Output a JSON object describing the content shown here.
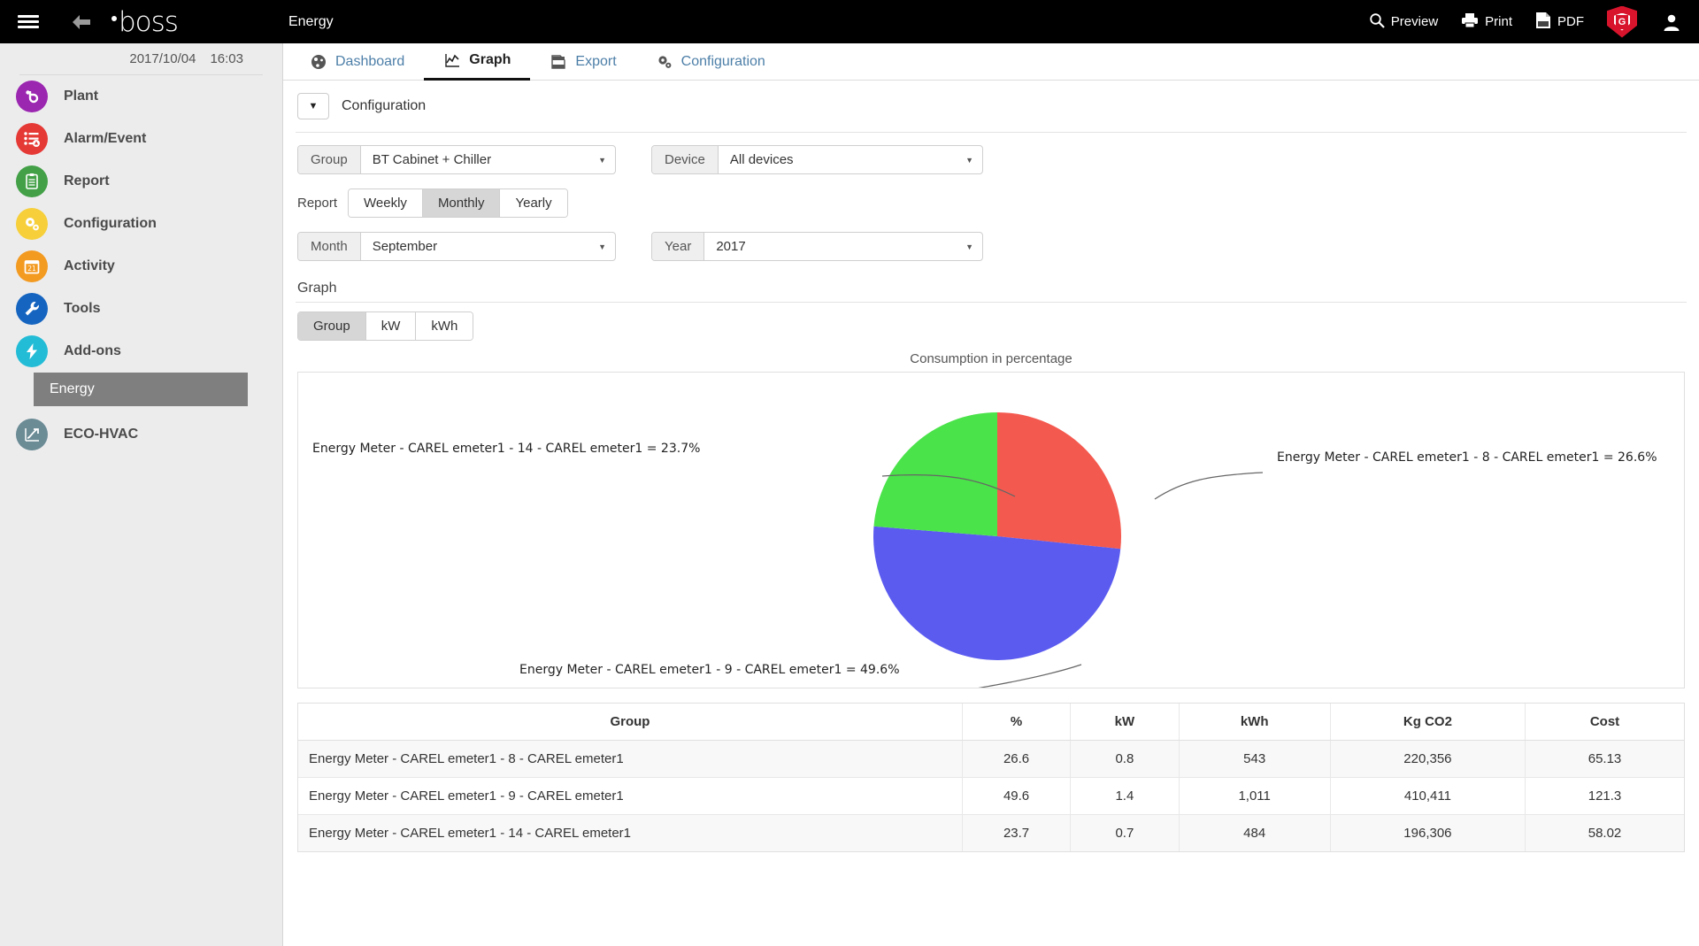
{
  "topbar": {
    "menu_icon": "hamburger-icon",
    "back_icon": "back-arrow-icon",
    "brand": "boss",
    "page_title": "Energy",
    "actions": [
      {
        "label": "Preview",
        "icon": "search-preview-icon"
      },
      {
        "label": "Print",
        "icon": "printer-icon"
      },
      {
        "label": "PDF",
        "icon": "pdf-file-icon"
      }
    ],
    "shield_badge": "G",
    "user_icon": "user-avatar-icon"
  },
  "sidebar": {
    "date": "2017/10/04",
    "time": "16:03",
    "items": [
      {
        "label": "Plant",
        "icon": "plant-logo-icon",
        "color": "#9b26b0"
      },
      {
        "label": "Alarm/Event",
        "icon": "alarm-list-icon",
        "color": "#e53935"
      },
      {
        "label": "Report",
        "icon": "clipboard-icon",
        "color": "#43a047"
      },
      {
        "label": "Configuration",
        "icon": "gears-icon",
        "color": "#f6cf3a"
      },
      {
        "label": "Activity",
        "icon": "calendar-icon",
        "color": "#f39a21"
      },
      {
        "label": "Tools",
        "icon": "wrench-icon",
        "color": "#1565c0"
      },
      {
        "label": "Add-ons",
        "icon": "lightning-icon",
        "color": "#23bcd6"
      }
    ],
    "sub_item": {
      "label": "Energy",
      "selected": true
    },
    "last_item": {
      "label": "ECO-HVAC",
      "icon": "trend-chart-icon",
      "color": "#6b8b95"
    }
  },
  "tabs": [
    {
      "label": "Dashboard",
      "icon": "dashboard-gauge-icon",
      "active": false
    },
    {
      "label": "Graph",
      "icon": "line-chart-icon",
      "active": true
    },
    {
      "label": "Export",
      "icon": "export-file-icon",
      "active": false
    },
    {
      "label": "Configuration",
      "icon": "gears-icon",
      "active": false
    }
  ],
  "configuration": {
    "title": "Configuration",
    "group_label": "Group",
    "group_value": "BT Cabinet + Chiller",
    "device_label": "Device",
    "device_value": "All devices",
    "report_label": "Report",
    "report_options": [
      "Weekly",
      "Monthly",
      "Yearly"
    ],
    "report_selected": "Monthly",
    "month_label": "Month",
    "month_value": "September",
    "year_label": "Year",
    "year_value": "2017",
    "graph_label": "Graph",
    "graph_options": [
      "Group",
      "kW",
      "kWh"
    ],
    "graph_selected": "Group"
  },
  "chart_data": {
    "type": "pie",
    "title": "Consumption in percentage",
    "categories": [
      "Energy Meter - CAREL emeter1 - 8 - CAREL emeter1",
      "Energy Meter - CAREL emeter1 - 9 - CAREL emeter1",
      "Energy Meter - CAREL emeter1 - 14 - CAREL emeter1"
    ],
    "values": [
      26.6,
      49.6,
      23.7
    ],
    "colors": [
      "#f4594f",
      "#5b5bf0",
      "#4ae34a"
    ],
    "labels": [
      "Energy Meter - CAREL emeter1 - 8 - CAREL emeter1 = 26.6%",
      "Energy Meter - CAREL emeter1 - 9 - CAREL emeter1 = 49.6%",
      "Energy Meter - CAREL emeter1 - 14 - CAREL emeter1 = 23.7%"
    ],
    "xlabel": "",
    "ylabel": "",
    "legend": "callout-labels"
  },
  "table": {
    "headers": [
      "Group",
      "%",
      "kW",
      "kWh",
      "Kg CO2",
      "Cost"
    ],
    "rows": [
      {
        "group": "Energy Meter - CAREL emeter1 - 8 - CAREL emeter1",
        "pct": "26.6",
        "kw": "0.8",
        "kwh": "543",
        "co2": "220,356",
        "cost": "65.13"
      },
      {
        "group": "Energy Meter - CAREL emeter1 - 9 - CAREL emeter1",
        "pct": "49.6",
        "kw": "1.4",
        "kwh": "1,011",
        "co2": "410,411",
        "cost": "121.3"
      },
      {
        "group": "Energy Meter - CAREL emeter1 - 14 - CAREL emeter1",
        "pct": "23.7",
        "kw": "0.7",
        "kwh": "484",
        "co2": "196,306",
        "cost": "58.02"
      }
    ]
  }
}
